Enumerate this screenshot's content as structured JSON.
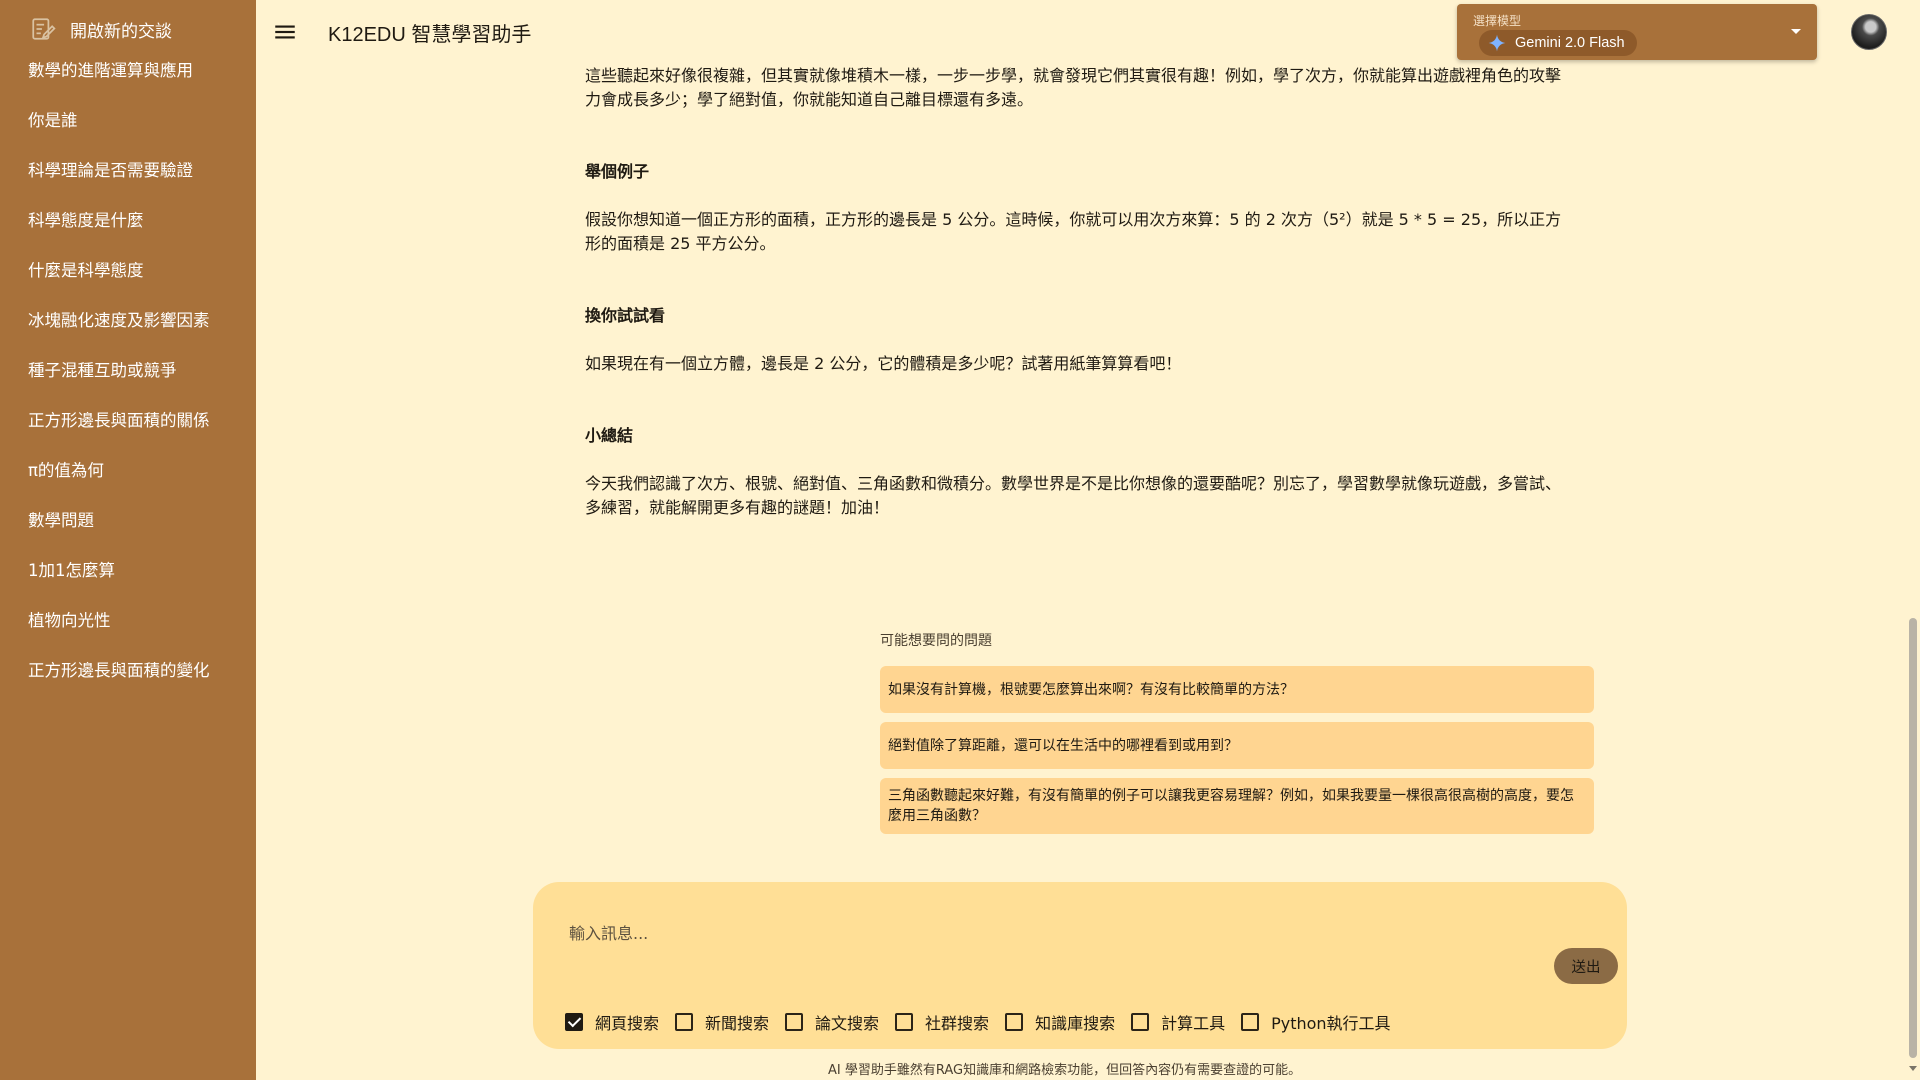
{
  "sidebar": {
    "new_chat_label": "開啟新的交談",
    "items": [
      {
        "label": "數學的進階運算與應用"
      },
      {
        "label": "你是誰"
      },
      {
        "label": "科學理論是否需要驗證"
      },
      {
        "label": "科學態度是什麼"
      },
      {
        "label": "什麼是科學態度"
      },
      {
        "label": "冰塊融化速度及影響因素"
      },
      {
        "label": "種子混種互助或競爭"
      },
      {
        "label": "正方形邊長與面積的關係"
      },
      {
        "label": "π的值為何"
      },
      {
        "label": "數學問題"
      },
      {
        "label": "1加1怎麼算"
      },
      {
        "label": "植物向光性"
      },
      {
        "label": "正方形邊長與面積的變化"
      }
    ]
  },
  "header": {
    "title": "K12EDU 智慧學習助手",
    "model_select": {
      "label": "選擇模型",
      "selected": "Gemini 2.0 Flash"
    }
  },
  "message": {
    "p1": "這些聽起來好像很複雜，但其實就像堆積木一樣，一步一步學，就會發現它們其實很有趣！例如，學了次方，你就能算出遊戲裡角色的攻擊力會成長多少；學了絕對值，你就能知道自己離目標還有多遠。",
    "h1": "舉個例子",
    "p2": "假設你想知道一個正方形的面積，正方形的邊長是 5 公分。這時候，你就可以用次方來算：5 的 2 次方（5²）就是 5 * 5 = 25，所以正方形的面積是 25 平方公分。",
    "h2": "換你試試看",
    "p3": "如果現在有一個立方體，邊長是 2 公分，它的體積是多少呢？試著用紙筆算算看吧！",
    "h3": "小總結",
    "p4": "今天我們認識了次方、根號、絕對值、三角函數和微積分。數學世界是不是比你想像的還要酷呢？別忘了，學習數學就像玩遊戲，多嘗試、多練習，就能解開更多有趣的謎題！加油！"
  },
  "suggestions": {
    "title": "可能想要問的問題",
    "items": [
      "如果沒有計算機，根號要怎麼算出來啊？有沒有比較簡單的方法？",
      "絕對值除了算距離，還可以在生活中的哪裡看到或用到？",
      "三角函數聽起來好難，有沒有簡單的例子可以讓我更容易理解？例如，如果我要量一棵很高很高樹的高度，要怎麼用三角函數？"
    ]
  },
  "composer": {
    "placeholder": "輸入訊息...",
    "send_label": "送出",
    "tools": [
      {
        "label": "網頁搜索",
        "checked": true
      },
      {
        "label": "新聞搜索",
        "checked": false
      },
      {
        "label": "論文搜索",
        "checked": false
      },
      {
        "label": "社群搜索",
        "checked": false
      },
      {
        "label": "知識庫搜索",
        "checked": false
      },
      {
        "label": "計算工具",
        "checked": false
      },
      {
        "label": "Python執行工具",
        "checked": false
      }
    ]
  },
  "footer": {
    "disclaimer": "AI 學習助手雖然有RAG知識庫和網路檢索功能，但回答內容仍有需要查證的可能。"
  },
  "colors": {
    "sidebar": "#A8713A",
    "background": "#FFF3D0",
    "suggestion": "#FFD591",
    "composer": "#FFDF96"
  }
}
